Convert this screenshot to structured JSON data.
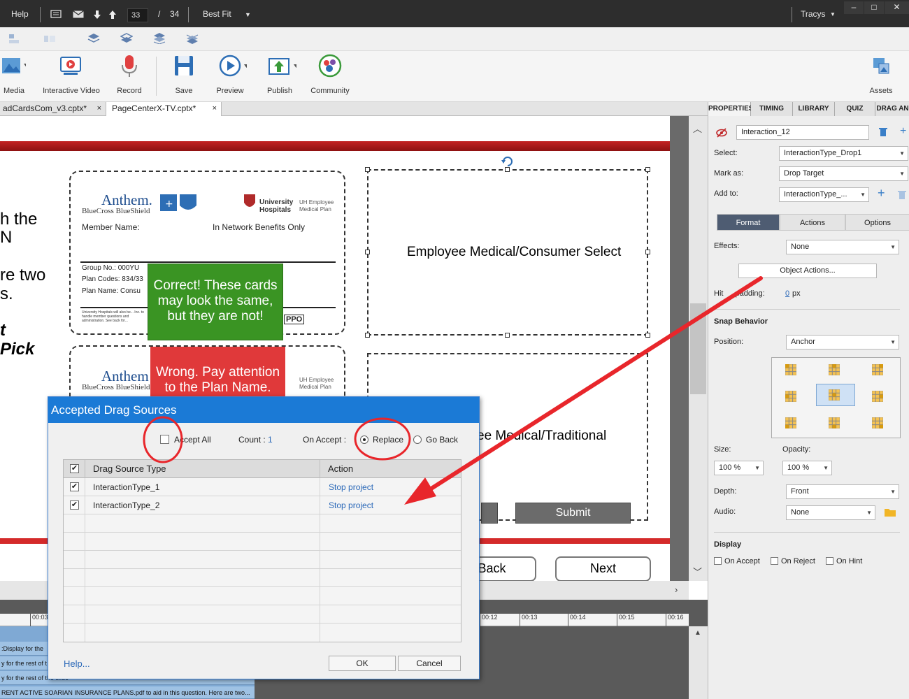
{
  "topbar": {
    "help": "Help",
    "page_current": "33",
    "page_sep": "/",
    "page_total": "34",
    "zoom": "Best Fit",
    "user": "Tracys"
  },
  "ribbon": {
    "media": "Media",
    "interactive_video": "Interactive Video",
    "record": "Record",
    "save": "Save",
    "preview": "Preview",
    "publish": "Publish",
    "community": "Community",
    "assets": "Assets"
  },
  "doc_tabs": [
    {
      "label": "adCardsCom_v3.cptx*",
      "close": "×"
    },
    {
      "label": "PageCenterX-TV.cptx*",
      "close": "×"
    }
  ],
  "slide": {
    "left_text": [
      "h the",
      "N",
      "re two",
      "s.",
      "t",
      "Pick"
    ],
    "card1": {
      "anthem": "Anthem.",
      "bcbs": "BlueCross BlueShield",
      "univ": "University",
      "hospitals": "Hospitals",
      "uh_employee": "UH Employee",
      "medical_plan": "Medical Plan",
      "member_name": "Member Name:",
      "in_network": "In Network Benefits Only",
      "group_no": "Group No.: 000YU",
      "plan_codes": "Plan Codes: 834/33",
      "plan_name": "Plan Name: Consu",
      "fine_print": "University Hospitals will also be... Inc. to handle member questions and administration. See back for...",
      "ppo": "PPO"
    },
    "card2": {
      "anthem": "Anthem",
      "bcbs": "BlueCross BlueShield",
      "uh_employee": "UH Employee",
      "medical_plan": "Medical Plan"
    },
    "correct_feedback": "Correct! These cards may look the same, but they are not!",
    "wrong_feedback": "Wrong. Pay attention to the Plan Name.",
    "target1": "Employee Medical/Consumer Select",
    "target2": "ee Medical/Traditional",
    "submit": "Submit",
    "back": "Back",
    "next": "Next"
  },
  "timeline": {
    "ticks": [
      "00:03",
      "00:12",
      "00:13",
      "00:14",
      "00:15",
      "00:16"
    ],
    "tracks": [
      ":Display for the",
      "y for the rest of t",
      "y for the rest of the slide",
      "RENT ACTIVE SOARIAN INSURANCE PLANS.pdf to aid in this question. Here are two..."
    ]
  },
  "panel": {
    "tabs": [
      "PROPERTIES",
      "TIMING",
      "LIBRARY",
      "QUIZ",
      "DRAG AN"
    ],
    "name_value": "Interaction_12",
    "select_label": "Select:",
    "select_value": "InteractionType_Drop1",
    "markas_label": "Mark as:",
    "markas_value": "Drop Target",
    "addto_label": "Add to:",
    "addto_value": "InteractionType_...",
    "subtabs": [
      "Format",
      "Actions",
      "Options"
    ],
    "effects_label": "Effects:",
    "effects_value": "None",
    "object_actions": "Object Actions...",
    "hit_label_a": "Hit",
    "hit_label_b": "padding:",
    "hit_value": "0",
    "hit_unit": "px",
    "snap_behavior": "Snap Behavior",
    "position_label": "Position:",
    "position_value": "Anchor",
    "size_label": "Size:",
    "size_value": "100 %",
    "opacity_label": "Opacity:",
    "opacity_value": "100 %",
    "depth_label": "Depth:",
    "depth_value": "Front",
    "audio_label": "Audio:",
    "audio_value": "None",
    "display_head": "Display",
    "on_accept": "On Accept",
    "on_reject": "On Reject",
    "on_hint": "On Hint"
  },
  "dialog": {
    "title": "Accepted Drag Sources",
    "accept_all": "Accept All",
    "count_label": "Count :",
    "count_value": "1",
    "on_accept_label": "On Accept :",
    "replace": "Replace",
    "go_back": "Go Back",
    "col_type": "Drag Source Type",
    "col_action": "Action",
    "rows": [
      {
        "type": "InteractionType_1",
        "action": "Stop project"
      },
      {
        "type": "InteractionType_2",
        "action": "Stop project"
      }
    ],
    "help": "Help...",
    "ok": "OK",
    "cancel": "Cancel"
  },
  "colors": {
    "annotation_red": "#e8262b",
    "dialog_blue": "#1b7ad6",
    "correct_green": "#3a9423",
    "wrong_red": "#e0393a",
    "brand_red": "#c32222"
  }
}
